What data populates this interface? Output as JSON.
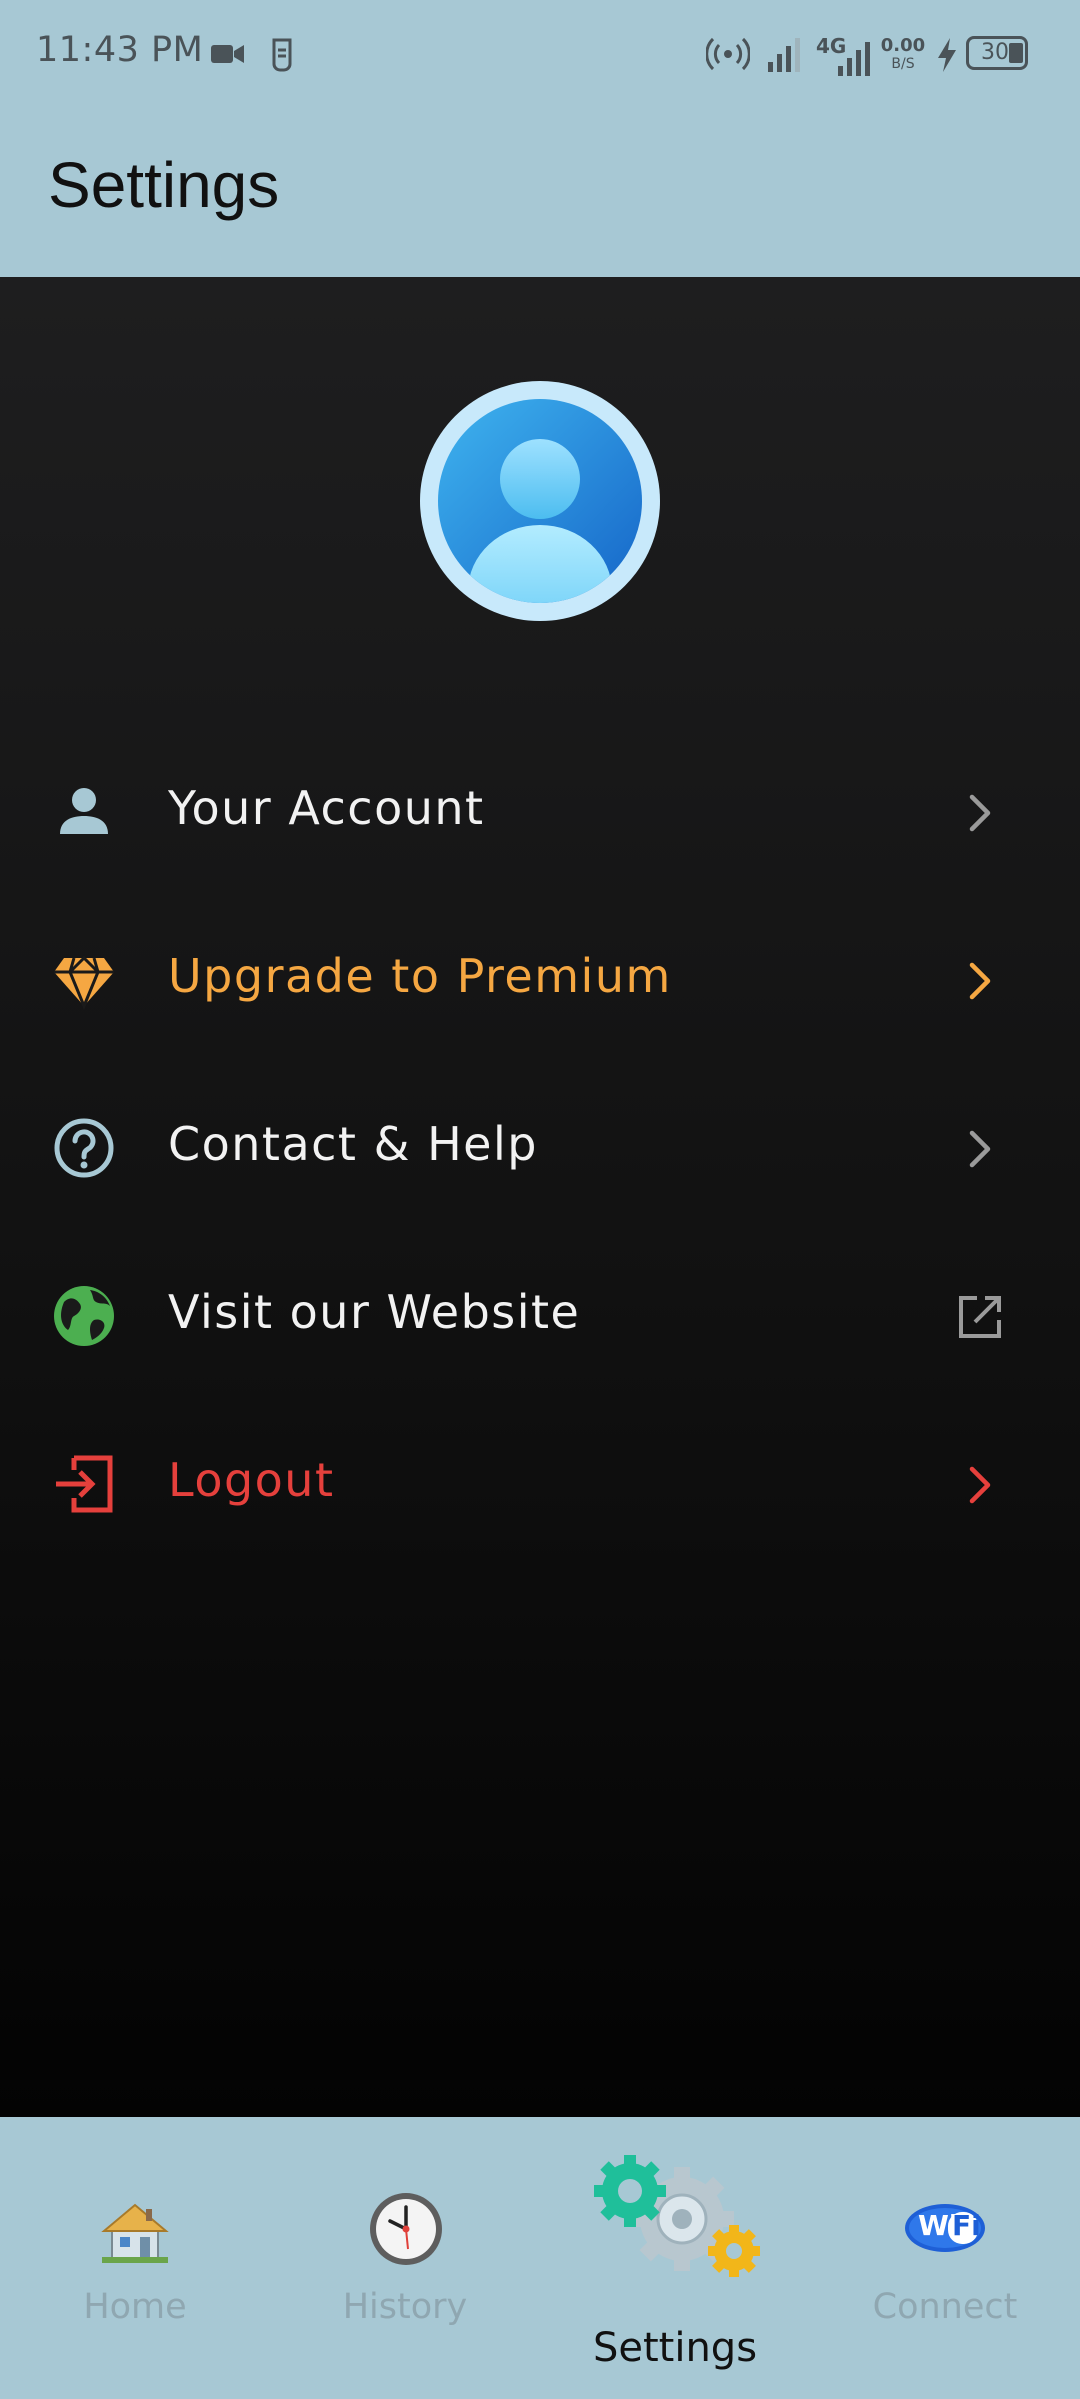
{
  "status_bar": {
    "time": "11:43 PM",
    "network_type": "4G",
    "data_speed_value": "0.00",
    "data_speed_unit": "B/S",
    "battery": "30"
  },
  "app_bar": {
    "title": "Settings"
  },
  "menu": [
    {
      "label": "Your Account",
      "icon": "person-icon",
      "trailing": "chevron-right-icon",
      "color": "#f2f2f2",
      "icon_color": "#a7c8d4"
    },
    {
      "label": "Upgrade to Premium",
      "icon": "diamond-icon",
      "trailing": "chevron-right-icon",
      "color": "#f5a742",
      "icon_color": "#f5a742"
    },
    {
      "label": "Contact & Help",
      "icon": "help-circle-icon",
      "trailing": "chevron-right-icon",
      "color": "#f2f2f2",
      "icon_color": "#a7c8d4"
    },
    {
      "label": "Visit our Website",
      "icon": "globe-icon",
      "trailing": "external-link-icon",
      "color": "#f2f2f2",
      "icon_color": "#4caf50"
    },
    {
      "label": "Logout",
      "icon": "logout-icon",
      "trailing": "chevron-right-icon",
      "color": "#e5403c",
      "icon_color": "#e5403c"
    }
  ],
  "bottom_nav": [
    {
      "label": "Home",
      "icon": "house-icon",
      "active": false
    },
    {
      "label": "History",
      "icon": "clock-icon",
      "active": false
    },
    {
      "label": "Settings",
      "icon": "gears-icon",
      "active": true
    },
    {
      "label": "Connect",
      "icon": "wifi-icon",
      "active": false
    }
  ],
  "colors": {
    "bar_background": "#a7c8d4",
    "screen_background": "#141414",
    "premium_accent": "#f5a742",
    "logout_accent": "#e5403c",
    "globe_green": "#4caf50",
    "inactive_nav_label": "#8fa7b1"
  }
}
